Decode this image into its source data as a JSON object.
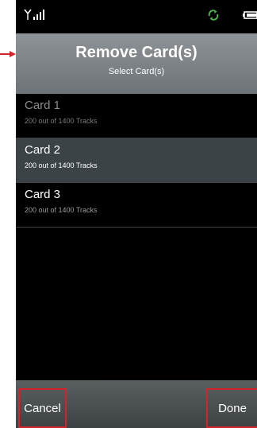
{
  "header": {
    "title": "Remove Card(s)",
    "subtitle": "Select Card(s)"
  },
  "cards": [
    {
      "name": "Card 1",
      "tracks": "200 out of 1400 Tracks",
      "state": "disabled"
    },
    {
      "name": "Card 2",
      "tracks": "200 out of 1400 Tracks",
      "state": "selected"
    },
    {
      "name": "Card 3",
      "tracks": "200 out of 1400 Tracks",
      "state": "normal"
    }
  ],
  "footer": {
    "cancel_label": "Cancel",
    "done_label": "Done"
  },
  "status_icons": [
    "signal-icon",
    "sync-icon",
    "battery-icon"
  ],
  "colors": {
    "annotation": "#d3242b",
    "sync": "#4caf50",
    "selected_row": "#3c4347"
  }
}
